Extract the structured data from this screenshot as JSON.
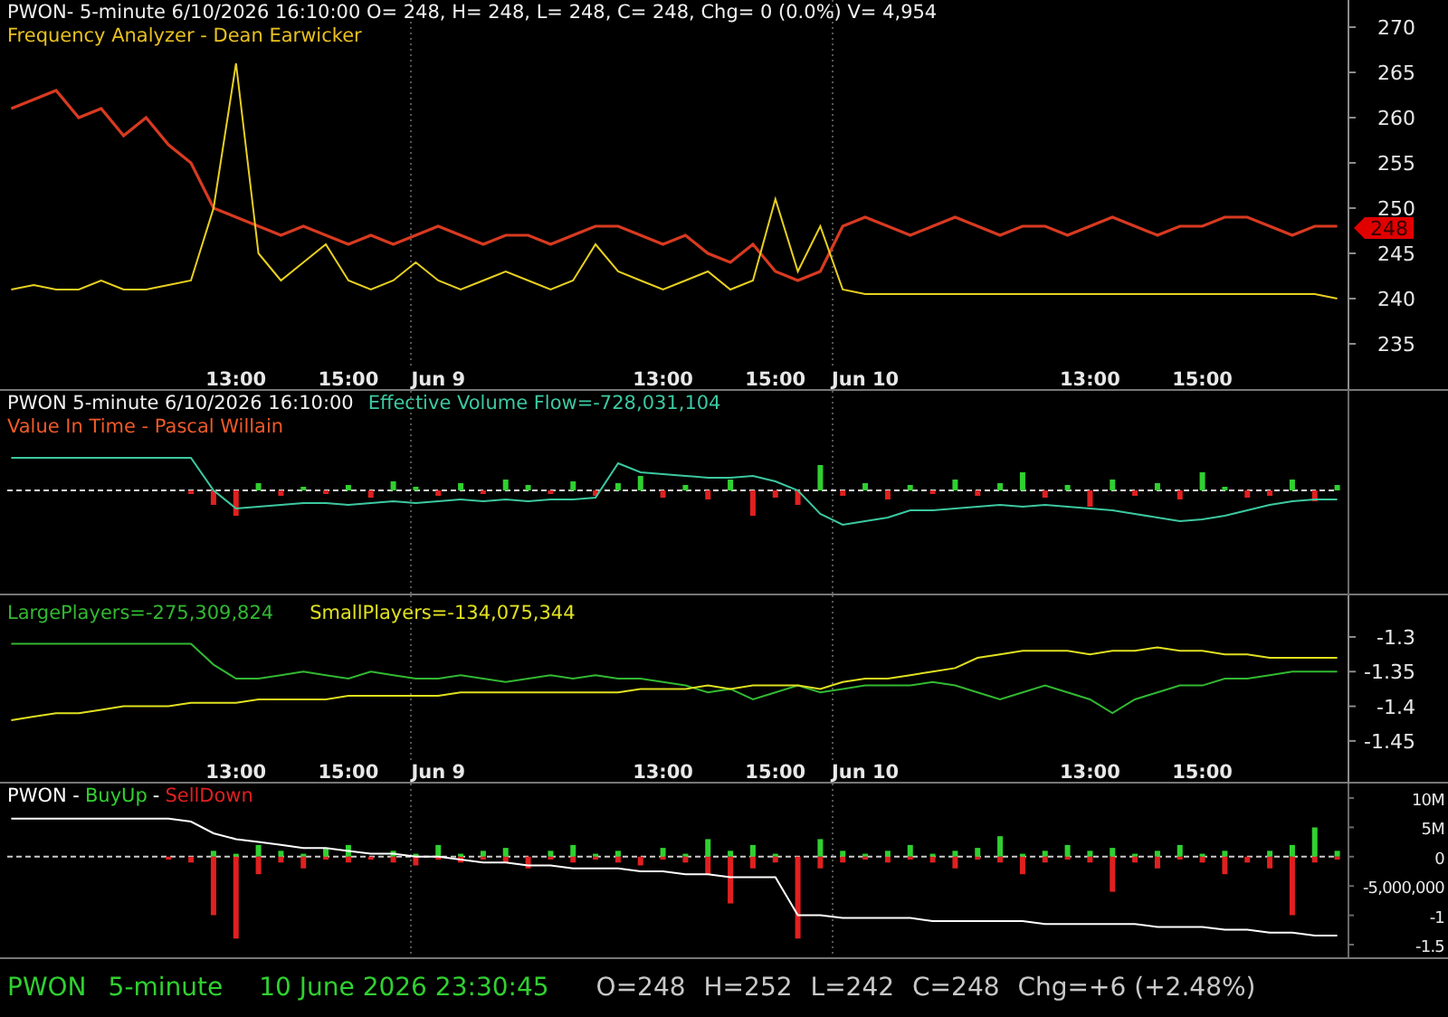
{
  "price_panel": {
    "title": "PWON- 5-minute 6/10/2026 16:10:00 O= 248, H= 248, L= 248, C= 248, Chg= 0 (0.0%) V= 4,954",
    "indicator": "Frequency Analyzer - Dean Earwicker",
    "chart_data": {
      "type": "line",
      "categories": [
        null,
        null,
        null,
        null,
        null,
        null,
        null,
        null,
        null,
        null,
        "13:00",
        null,
        null,
        null,
        null,
        "15:00",
        null,
        null,
        null,
        "Jun 9",
        null,
        null,
        null,
        null,
        null,
        null,
        null,
        null,
        null,
        "13:00",
        null,
        null,
        null,
        null,
        "15:00",
        null,
        null,
        null,
        "Jun 10",
        null,
        null,
        null,
        null,
        null,
        null,
        null,
        null,
        null,
        "13:00",
        null,
        null,
        null,
        null,
        "15:00",
        null,
        null,
        null,
        null,
        null,
        null
      ],
      "ylim": [
        230,
        273
      ],
      "yticks": [
        270,
        265,
        260,
        255,
        250,
        245,
        240,
        235
      ],
      "series": [
        {
          "color": "#d83a20",
          "values": [
            261,
            262,
            263,
            260,
            261,
            258,
            260,
            257,
            255,
            250,
            249,
            248,
            247,
            248,
            247,
            246,
            247,
            246,
            247,
            248,
            247,
            246,
            247,
            247,
            246,
            247,
            248,
            248,
            247,
            246,
            247,
            245,
            244,
            246,
            243,
            242,
            243,
            248,
            249,
            248,
            247,
            248,
            249,
            248,
            247,
            248,
            248,
            247,
            248,
            249,
            248,
            247,
            248,
            248,
            249,
            249,
            248,
            247,
            248,
            248
          ]
        },
        {
          "color": "#e8d020",
          "values": [
            241,
            241.5,
            241,
            241,
            242,
            241,
            241,
            241.5,
            242,
            250,
            266,
            245,
            242,
            244,
            246,
            242,
            241,
            242,
            244,
            242,
            241,
            242,
            243,
            242,
            241,
            242,
            246,
            243,
            242,
            241,
            242,
            243,
            241,
            242,
            251,
            243,
            248,
            241,
            240.5,
            240.5,
            240.5,
            240.5,
            240.5,
            240.5,
            240.5,
            240.5,
            240.5,
            240.5,
            240.5,
            240.5,
            240.5,
            240.5,
            240.5,
            240.5,
            240.5,
            240.5,
            240.5,
            240.5,
            240.5,
            240
          ]
        }
      ],
      "annotations": [
        "248"
      ]
    }
  },
  "flow_panel": {
    "title": "PWON 5-minute  6/10/2026 16:10:00",
    "reading": "Effective Volume Flow=-728,031,104",
    "indicator": "Value In Time - Pascal Willain"
  },
  "players_panel": {
    "readings": [
      {
        "text": "LargePlayers=-275,309,824",
        "color": "#32b832"
      },
      {
        "text": "SmallPlayers=-134,075,344",
        "color": "#e0e020"
      }
    ],
    "chart_data": {
      "type": "line",
      "categories": [
        null,
        null,
        null,
        null,
        null,
        null,
        null,
        null,
        null,
        null,
        "13:00",
        null,
        null,
        null,
        null,
        "15:00",
        null,
        null,
        null,
        "Jun 9",
        null,
        null,
        null,
        null,
        null,
        null,
        null,
        null,
        null,
        "13:00",
        null,
        null,
        null,
        null,
        "15:00",
        null,
        null,
        null,
        "Jun 10",
        null,
        null,
        null,
        null,
        null,
        null,
        null,
        null,
        null,
        "13:00",
        null,
        null,
        null,
        null,
        "15:00",
        null,
        null,
        null,
        null,
        null,
        null
      ],
      "ylim": [
        -1.5115,
        -1.24
      ],
      "yticks": [
        -1.3,
        -1.35,
        -1.4,
        -1.45
      ],
      "series": [
        {
          "color": "#32b832",
          "values": [
            -1.31,
            -1.31,
            -1.31,
            -1.31,
            -1.31,
            -1.31,
            -1.31,
            -1.31,
            -1.31,
            -1.34,
            -1.36,
            -1.36,
            -1.355,
            -1.35,
            -1.355,
            -1.36,
            -1.35,
            -1.355,
            -1.36,
            -1.36,
            -1.355,
            -1.36,
            -1.365,
            -1.36,
            -1.355,
            -1.36,
            -1.355,
            -1.36,
            -1.36,
            -1.365,
            -1.37,
            -1.38,
            -1.375,
            -1.39,
            -1.38,
            -1.37,
            -1.38,
            -1.375,
            -1.37,
            -1.37,
            -1.37,
            -1.365,
            -1.37,
            -1.38,
            -1.39,
            -1.38,
            -1.37,
            -1.38,
            -1.39,
            -1.41,
            -1.39,
            -1.38,
            -1.37,
            -1.37,
            -1.36,
            -1.36,
            -1.355,
            -1.35,
            -1.35,
            -1.35
          ]
        },
        {
          "color": "#e0e020",
          "values": [
            -1.42,
            -1.415,
            -1.41,
            -1.41,
            -1.405,
            -1.4,
            -1.4,
            -1.4,
            -1.395,
            -1.395,
            -1.395,
            -1.39,
            -1.39,
            -1.39,
            -1.39,
            -1.385,
            -1.385,
            -1.385,
            -1.385,
            -1.385,
            -1.38,
            -1.38,
            -1.38,
            -1.38,
            -1.38,
            -1.38,
            -1.38,
            -1.38,
            -1.375,
            -1.375,
            -1.375,
            -1.37,
            -1.375,
            -1.37,
            -1.37,
            -1.37,
            -1.375,
            -1.365,
            -1.36,
            -1.36,
            -1.355,
            -1.35,
            -1.345,
            -1.33,
            -1.325,
            -1.32,
            -1.32,
            -1.32,
            -1.325,
            -1.32,
            -1.32,
            -1.315,
            -1.32,
            -1.32,
            -1.325,
            -1.325,
            -1.33,
            -1.33,
            -1.33,
            -1.33
          ]
        }
      ]
    }
  },
  "buy_sell_panel": {
    "title_parts": [
      {
        "text": "PWON -",
        "color": "#ffffff"
      },
      {
        "text": "BuyUp",
        "color": "#30d030"
      },
      {
        "text": "-",
        "color": "#ffffff"
      },
      {
        "text": "SellDown",
        "color": "#e02020"
      }
    ],
    "y_axis": [
      "10M",
      "5M",
      "0",
      "-5,000,000",
      "-1",
      "-1.5"
    ]
  },
  "status_bar": {
    "symbol": "PWON",
    "interval": "5-minute",
    "datetime": "10 June 2026 23:30:45",
    "quote": [
      "O=248",
      "H=252",
      "L=242",
      "C=248",
      "Chg=+6 (+2.48%)"
    ]
  }
}
